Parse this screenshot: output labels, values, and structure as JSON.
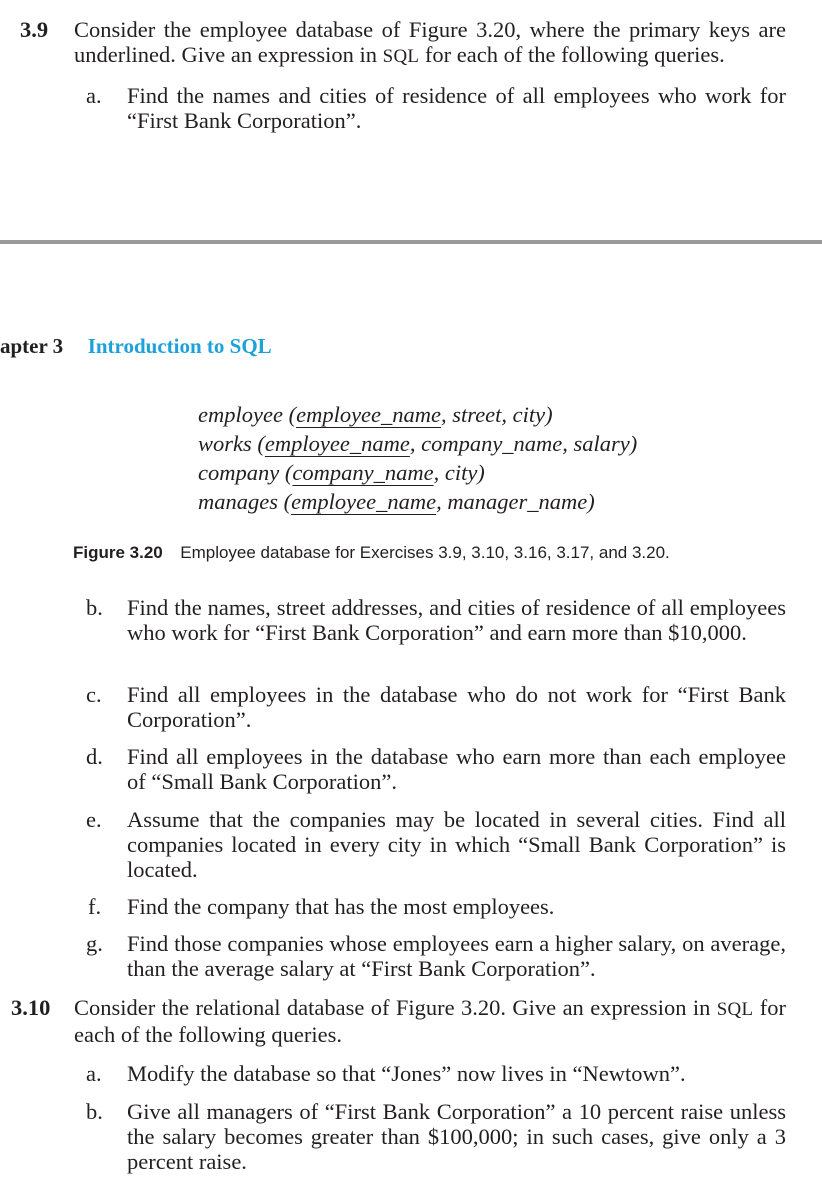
{
  "top": {
    "ex39_num": "3.9",
    "ex39_text": "Consider the employee database of Figure 3.20, where the primary keys are underlined. Give an expression in",
    "ex39_sql": "SQL",
    "ex39_text_tail": "for each of the following queries.",
    "item_a_label": "a.",
    "item_a_text": "Find the names and cities of residence of all employees who work for “First Bank Corporation”."
  },
  "header": {
    "chapter_label": "apter 3",
    "chapter_title": "Introduction to SQL"
  },
  "figure": {
    "rows": [
      {
        "rel": "employee",
        "open": " (",
        "pk": "employee_name",
        "rest": ", street, city)"
      },
      {
        "rel": "works",
        "open": " (",
        "pk": "employee_name",
        "rest": ", company_name, salary)"
      },
      {
        "rel": "company",
        "open": " (",
        "pk": "company_name",
        "rest": ", city)"
      },
      {
        "rel": "manages",
        "open": " (",
        "pk": "employee_name",
        "rest": ", manager_name)"
      }
    ],
    "caption_label": "Figure 3.20",
    "caption_text": "Employee database for Exercises 3.9, 3.10, 3.16, 3.17, and 3.20."
  },
  "items39": [
    {
      "label": "b.",
      "text": "Find the names, street addresses, and cities of residence of all employees who work for “First Bank Corporation” and earn more than $10,000."
    },
    {
      "label": "c.",
      "text": "Find all employees in the database who do not work for “First Bank Corporation”."
    },
    {
      "label": "d.",
      "text": "Find all employees in the database who earn more than each employee of “Small Bank Corporation”."
    },
    {
      "label": "e.",
      "text": "Assume that the companies may be located in several cities. Find all companies located in every city in which “Small Bank Corporation” is located."
    },
    {
      "label": "f.",
      "text": "Find the company that has the most employees."
    },
    {
      "label": "g.",
      "text": "Find those companies whose employees earn a higher salary, on average, than the average salary at “First Bank Corporation”."
    }
  ],
  "ex310": {
    "num": "3.10",
    "text": "Consider the relational database of Figure 3.20. Give an expression in",
    "sql": "SQL",
    "text_tail": "for each of the following queries.",
    "items": [
      {
        "label": "a.",
        "text": "Modify the database so that “Jones” now lives in “Newtown”."
      },
      {
        "label": "b.",
        "text": "Give all managers of “First Bank Corporation” a 10 percent raise unless the salary becomes greater than $100,000; in such cases, give only a 3 percent raise."
      }
    ]
  }
}
